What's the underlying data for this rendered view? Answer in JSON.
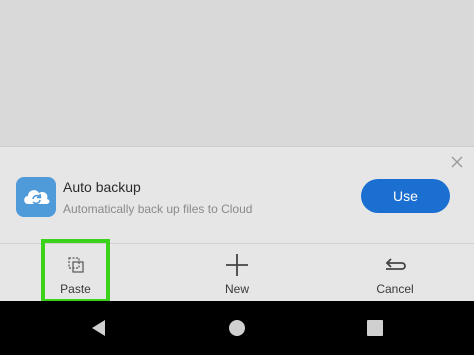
{
  "banner": {
    "title": "Auto backup",
    "subtitle": "Automatically back up files to Cloud",
    "use_label": "Use",
    "icon": "cloud-sync-icon",
    "close_icon": "close-icon",
    "accent_color": "#1a6fd1",
    "icon_color": "#4f9ad9"
  },
  "toolbar": {
    "paste_label": "Paste",
    "new_label": "New",
    "cancel_label": "Cancel",
    "paste_icon": "paste-icon",
    "new_icon": "plus-icon",
    "cancel_icon": "undo-arrow-icon",
    "highlight_color": "#3bd21a"
  },
  "navbar": {
    "back_icon": "back-triangle-icon",
    "home_icon": "home-circle-icon",
    "recents_icon": "recents-square-icon"
  }
}
